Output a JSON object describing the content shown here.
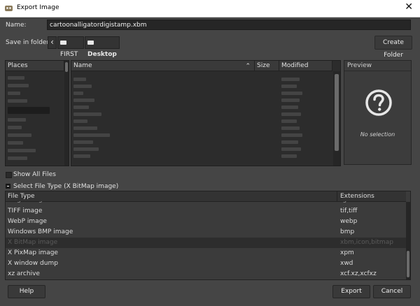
{
  "window": {
    "title": "Export Image",
    "close_glyph": "✕"
  },
  "name_label": "Name:",
  "filename": "cartoonalligatordigistamp.xbm",
  "save_in_label": "Save in folder:",
  "path": {
    "back_glyph": "‹",
    "crumbs": [
      "FIRST",
      "Desktop"
    ]
  },
  "create_folder": "Create Folder",
  "places_header": "Places",
  "files_header": {
    "name": "Name",
    "size": "Size",
    "modified": "Modified",
    "sort_glyph": "⌃"
  },
  "preview": {
    "header": "Preview",
    "icon": "question-icon",
    "empty_text": "No selection"
  },
  "show_all_files": "Show All Files",
  "select_file_type": "Select File Type (X BitMap image)",
  "filetype_headers": {
    "type": "File Type",
    "ext": "Extensions"
  },
  "filetypes": [
    {
      "type": "TIFF image",
      "ext": "tif,tiff"
    },
    {
      "type": "WebP image",
      "ext": "webp"
    },
    {
      "type": "Windows BMP image",
      "ext": "bmp"
    },
    {
      "type": "X BitMap image",
      "ext": "xbm,icon,bitmap"
    },
    {
      "type": "X PixMap image",
      "ext": "xpm"
    },
    {
      "type": "X window dump",
      "ext": "xwd"
    },
    {
      "type": "xz archive",
      "ext": "xcf.xz,xcfxz"
    }
  ],
  "buttons": {
    "help": "Help",
    "export": "Export",
    "cancel": "Cancel"
  }
}
